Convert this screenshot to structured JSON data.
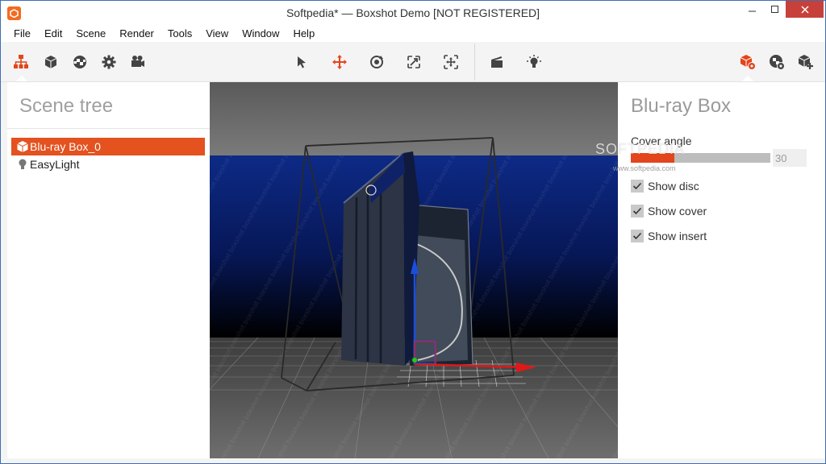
{
  "window": {
    "title": "Softpedia* — Boxshot Demo [NOT REGISTERED]"
  },
  "menu": [
    "File",
    "Edit",
    "Scene",
    "Render",
    "Tools",
    "View",
    "Window",
    "Help"
  ],
  "toolbar": {
    "left": [
      "scene-tree-icon",
      "cube-icon",
      "materials-icon",
      "gear-icon",
      "camera-icon"
    ],
    "center": [
      "select-icon",
      "move-icon",
      "rotate-icon",
      "scale-icon",
      "fit-icon"
    ],
    "render": [
      "clapperboard-icon",
      "light-icon"
    ],
    "right": [
      "object-properties-icon",
      "material-properties-icon",
      "add-object-icon"
    ],
    "accent_color": "#e3451c"
  },
  "scene_tree": {
    "title": "Scene tree",
    "items": [
      {
        "label": "Blu-ray Box_0",
        "icon": "box-icon",
        "selected": true
      },
      {
        "label": "EasyLight",
        "icon": "bulb-icon",
        "selected": false
      }
    ]
  },
  "viewport": {
    "watermark_text": "boxshot demo"
  },
  "properties": {
    "title": "Blu-ray Box",
    "cover_angle": {
      "label": "Cover angle",
      "value": "30",
      "fraction": 0.31
    },
    "checks": [
      {
        "label": "Show disc",
        "checked": true
      },
      {
        "label": "Show cover",
        "checked": true
      },
      {
        "label": "Show insert",
        "checked": true
      }
    ]
  },
  "overlay": {
    "softpedia_logo": "SOFTPEDIA",
    "softpedia_url": "www.softpedia.com"
  }
}
